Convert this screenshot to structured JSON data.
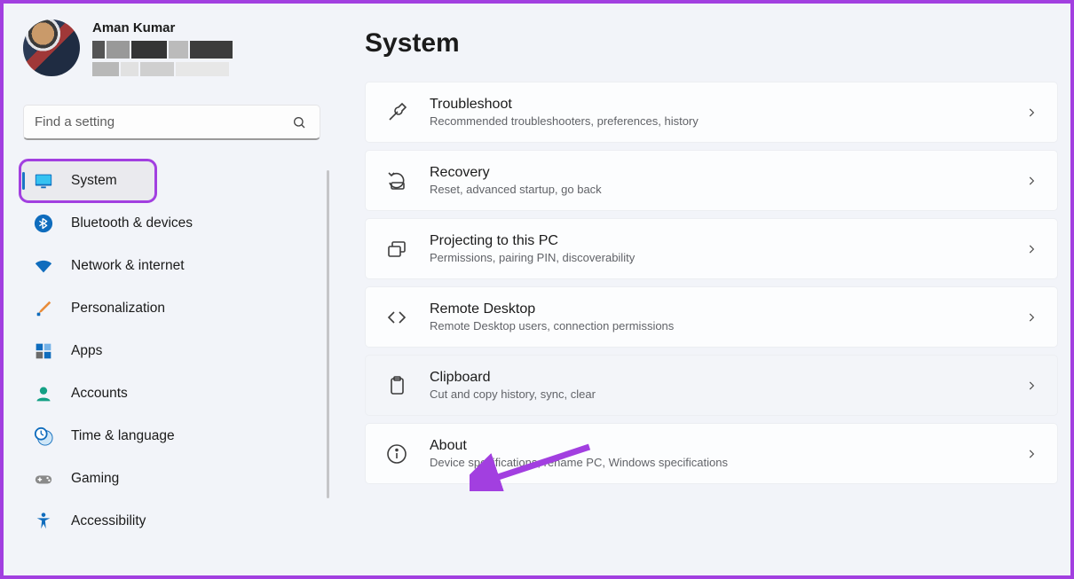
{
  "user": {
    "name": "Aman Kumar"
  },
  "search": {
    "placeholder": "Find a setting"
  },
  "sidebar": {
    "items": [
      {
        "label": "System",
        "icon": "display-icon",
        "active": true,
        "highlighted": true
      },
      {
        "label": "Bluetooth & devices",
        "icon": "bluetooth-icon"
      },
      {
        "label": "Network & internet",
        "icon": "wifi-icon"
      },
      {
        "label": "Personalization",
        "icon": "brush-icon"
      },
      {
        "label": "Apps",
        "icon": "apps-icon"
      },
      {
        "label": "Accounts",
        "icon": "person-icon"
      },
      {
        "label": "Time & language",
        "icon": "clock-globe-icon"
      },
      {
        "label": "Gaming",
        "icon": "gamepad-icon"
      },
      {
        "label": "Accessibility",
        "icon": "accessibility-icon"
      }
    ]
  },
  "page": {
    "title": "System"
  },
  "cards": [
    {
      "title": "Troubleshoot",
      "subtitle": "Recommended troubleshooters, preferences, history",
      "icon": "wrench-icon"
    },
    {
      "title": "Recovery",
      "subtitle": "Reset, advanced startup, go back",
      "icon": "recovery-icon"
    },
    {
      "title": "Projecting to this PC",
      "subtitle": "Permissions, pairing PIN, discoverability",
      "icon": "project-icon"
    },
    {
      "title": "Remote Desktop",
      "subtitle": "Remote Desktop users, connection permissions",
      "icon": "remote-icon"
    },
    {
      "title": "Clipboard",
      "subtitle": "Cut and copy history, sync, clear",
      "icon": "clipboard-icon",
      "muted": true
    },
    {
      "title": "About",
      "subtitle": "Device specifications, rename PC, Windows specifications",
      "icon": "info-icon"
    }
  ],
  "annotations": {
    "arrow_target": "About"
  },
  "colors": {
    "highlight": "#a23fe0",
    "accent": "#1975c5"
  }
}
